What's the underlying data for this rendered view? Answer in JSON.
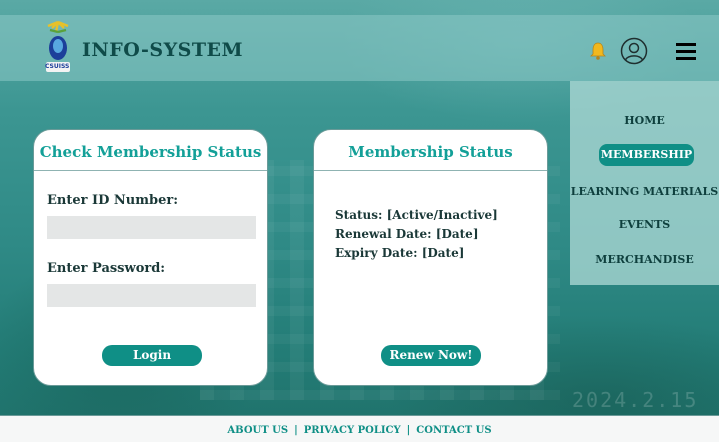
{
  "header": {
    "site_title": "INFO-SYSTEM",
    "logo_text": "CSUISS"
  },
  "nav": {
    "items": [
      {
        "label": "HOME",
        "active": false
      },
      {
        "label": "MEMBERSHIP",
        "active": true
      },
      {
        "label": "LEARNING MATERIALS",
        "active": false
      },
      {
        "label": "EVENTS",
        "active": false
      },
      {
        "label": "MERCHANDISE",
        "active": false
      }
    ]
  },
  "check_card": {
    "title": "Check Membership Status",
    "id_label": "Enter ID Number:",
    "id_value": "",
    "password_label": "Enter Password:",
    "password_value": "",
    "login_label": "Login"
  },
  "status_card": {
    "title": "Membership Status",
    "status_line": "Status: [Active/Inactive]",
    "renewal_line": "Renewal Date: [Date]",
    "expiry_line": "Expiry Date: [Date]",
    "renew_label": "Renew Now!"
  },
  "footer": {
    "about": "ABOUT US",
    "privacy": "PRIVACY POLICY",
    "contact": "CONTACT US",
    "separator": "|"
  },
  "background": {
    "stamp": "2024.2.15"
  },
  "colors": {
    "accent": "#0f8f86",
    "title": "#13a098",
    "header_bg": "#8cc8c6",
    "nav_bg": "#aad7d4"
  },
  "icons": [
    "bell-icon",
    "user-account-icon",
    "hamburger-menu-icon",
    "logo-icon"
  ]
}
